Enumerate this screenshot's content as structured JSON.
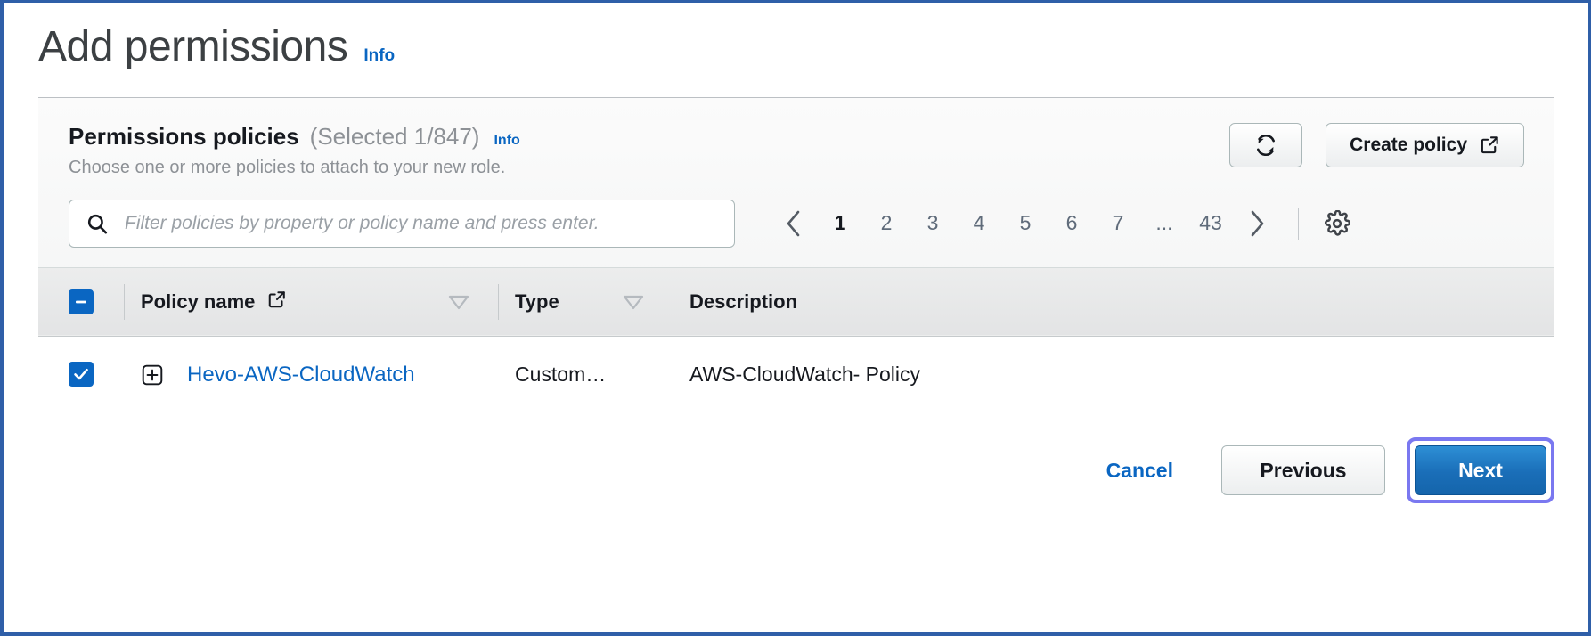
{
  "page": {
    "title": "Add permissions",
    "info_label": "Info"
  },
  "panel": {
    "title": "Permissions policies",
    "count_label": "(Selected 1/847)",
    "info_label": "Info",
    "subtitle": "Choose one or more policies to attach to your new role.",
    "refresh_icon": "refresh-icon",
    "create_policy_label": "Create policy",
    "create_policy_icon": "external-link-icon"
  },
  "filter": {
    "search_icon": "search-icon",
    "placeholder": "Filter policies by property or policy name and press enter.",
    "value": ""
  },
  "pagination": {
    "prev_icon": "chevron-left-icon",
    "next_icon": "chevron-right-icon",
    "pages": [
      "1",
      "2",
      "3",
      "4",
      "5",
      "6",
      "7",
      "...",
      "43"
    ],
    "active_page": "1",
    "settings_icon": "gear-icon"
  },
  "table": {
    "select_all_state": "indeterminate",
    "columns": [
      {
        "label": "Policy name",
        "icon": "external-link-icon",
        "sortable": true
      },
      {
        "label": "Type",
        "icon": "",
        "sortable": true
      },
      {
        "label": "Description",
        "icon": "",
        "sortable": false
      }
    ],
    "rows": [
      {
        "checked": true,
        "expand_icon": "plus-square-icon",
        "policy_name": "Hevo-AWS-CloudWatch",
        "type": "Custom…",
        "description": "AWS-CloudWatch- Policy"
      }
    ]
  },
  "footer": {
    "cancel_label": "Cancel",
    "previous_label": "Previous",
    "next_label": "Next"
  },
  "colors": {
    "link_blue": "#0a66c2",
    "primary_button": "#1a6eb8",
    "focus_ring": "#7a78f0",
    "frame_border": "#2f5fa8",
    "muted_text": "#8d9196"
  }
}
